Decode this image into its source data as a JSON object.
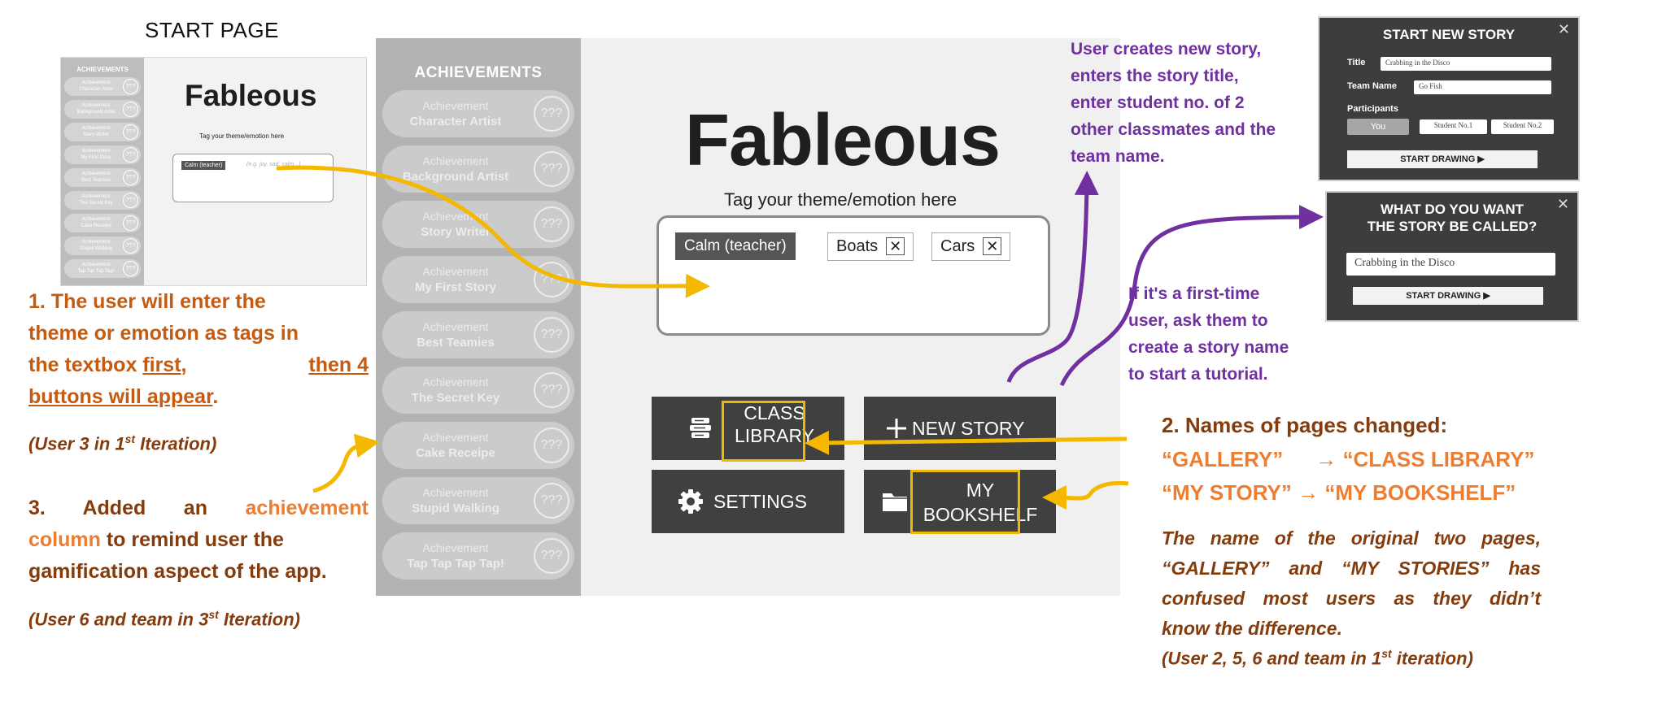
{
  "thumbnail": {
    "title": "START PAGE",
    "app_title": "Fableous",
    "sidebar_header": "ACHIEVEMENTS",
    "tag_label": "Tag your theme/emotion here",
    "chip": "Calm (teacher)",
    "placeholder": "(e.g. joy, sad, calm...)",
    "achievements": [
      {
        "l1": "Achievement",
        "l2": "Character Artist"
      },
      {
        "l1": "Achievement",
        "l2": "Background Artist"
      },
      {
        "l1": "Achievement",
        "l2": "Story Writer"
      },
      {
        "l1": "Achievement",
        "l2": "My First Story"
      },
      {
        "l1": "Achievement",
        "l2": "Best Teamies"
      },
      {
        "l1": "Achievement",
        "l2": "The Secret Key"
      },
      {
        "l1": "Achievement",
        "l2": "Cake Receipe"
      },
      {
        "l1": "Achievement",
        "l2": "Stupid Walking"
      },
      {
        "l1": "Achievement",
        "l2": "Tap Tap Tap Tap!"
      }
    ]
  },
  "main": {
    "sidebar_header": "ACHIEVEMENTS",
    "achievements": [
      {
        "l1": "Achievement",
        "l2": "Character Artist",
        "badge": "???"
      },
      {
        "l1": "Achievement",
        "l2": "Background Artist",
        "badge": "???"
      },
      {
        "l1": "Achievement",
        "l2": "Story Writer",
        "badge": "???"
      },
      {
        "l1": "Achievement",
        "l2": "My First Story",
        "badge": "???"
      },
      {
        "l1": "Achievement",
        "l2": "Best Teamies",
        "badge": "???"
      },
      {
        "l1": "Achievement",
        "l2": "The Secret Key",
        "badge": "???"
      },
      {
        "l1": "Achievement",
        "l2": "Cake Receipe",
        "badge": "???"
      },
      {
        "l1": "Achievement",
        "l2": "Stupid Walking",
        "badge": "???"
      },
      {
        "l1": "Achievement",
        "l2": "Tap Tap Tap Tap!",
        "badge": "???"
      }
    ],
    "app_title": "Fableous",
    "tag_label": "Tag your theme/emotion here",
    "chips": {
      "teacher": "Calm (teacher)",
      "chip1": "Boats",
      "chip2": "Cars",
      "remove": "✕"
    },
    "buttons": {
      "class_library_1": "CLASS",
      "class_library_2": "LIBRARY",
      "new_story": "NEW STORY",
      "settings": "SETTINGS",
      "bookshelf_1": "MY",
      "bookshelf_2": "BOOKSHELF"
    },
    "icons": [
      "books-icon",
      "plus-icon",
      "gear-icon",
      "folder-icon"
    ]
  },
  "dialog_new_story": {
    "title": "START NEW STORY",
    "close": "✕",
    "title_label": "Title",
    "title_value": "Crabbing in the Disco",
    "team_label": "Team Name",
    "team_value": "Go Fish",
    "participants_label": "Participants",
    "you": "You",
    "student1": "Student No.1",
    "student2": "Student No.2",
    "start": "START DRAWING ▶"
  },
  "dialog_name_story": {
    "title_1": "WHAT DO YOU WANT",
    "title_2": "THE STORY BE CALLED?",
    "close": "✕",
    "value": "Crabbing in the Disco",
    "start": "START DRAWING ▶"
  },
  "annotations": {
    "purple_new_story": [
      "User creates new story,",
      "enters the story title,",
      "enter student no. of 2",
      "other classmates and the",
      "team name."
    ],
    "purple_first_time": [
      "If it's a first-time",
      "user, ask them to",
      "create a story name",
      "to start a tutorial."
    ],
    "note1_part1": "1. The user will enter the",
    "note1_part2": "theme or emotion as tags in",
    "note1_part3a": "the textbox ",
    "note1_part3b": "first",
    "note1_part3c": ", ",
    "note1_part3d": "then 4",
    "note1_part4a": "buttons will appear",
    "note1_part4b": ".",
    "note1_iter_a": "(User 3 in 1",
    "note1_iter_sup": "st",
    "note1_iter_b": " Iteration)",
    "note3_a": "3. Added an ",
    "note3_b": "achievement",
    "note3_c": "column",
    "note3_d": " to remind user the",
    "note3_e": "gamification aspect of the app.",
    "note3_iter_a": "(User 6 and team in 3",
    "note3_iter_sup": "st",
    "note3_iter_b": " Iteration)",
    "note2_head": "2. Names of pages changed:",
    "note2_line1a": "“GALLERY”",
    "note2_line1b": "→ “CLASS LIBRARY”",
    "note2_line2": "“MY STORY” → “MY BOOKSHELF”",
    "note2_body": [
      "The name of the original two pages,",
      "“GALLERY” and “MY STORIES” has",
      "confused most users as they didn’t",
      "know the difference."
    ],
    "note2_iter_a": "(User 2, 5, 6 and team in 1",
    "note2_iter_sup": "st",
    "note2_iter_b": " iteration)"
  },
  "colors": {
    "orange": "#c55a11",
    "dark_orange": "#843c0c",
    "purple": "#7030a0",
    "arrow_yellow": "#f5b800",
    "arrow_purple": "#7030a0",
    "button": "#404040"
  }
}
